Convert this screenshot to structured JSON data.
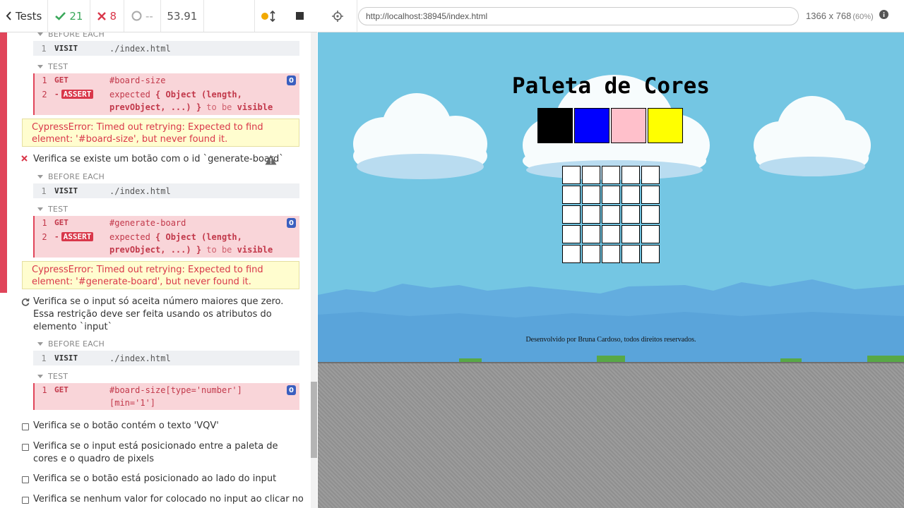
{
  "reporter": {
    "tests_label": "Tests",
    "passed": "21",
    "failed": "8",
    "pending": "--",
    "duration": "53.91",
    "colors": {
      "pass": "#3aa85a",
      "fail": "#d9374a",
      "badge": "#3a5fbf"
    }
  },
  "runnables": {
    "block1": {
      "before_each": "BEFORE EACH",
      "visit_num": "1",
      "visit_name": "VISIT",
      "visit_url": "./index.html",
      "test_label": "TEST",
      "get_num": "1",
      "get_name": "GET",
      "get_selector": "#board-size",
      "get_count": "0",
      "assert_num": "2",
      "assert_dash": "-",
      "assert_name": "ASSERT",
      "assert_expected": "expected",
      "assert_object": "{ Object (length,",
      "assert_object2": "prevObject, ...) }",
      "assert_tobe": "to be",
      "assert_visible": "visible",
      "error": "CypressError: Timed out retrying: Expected to find element: '#board-size', but never found it."
    },
    "test2": {
      "title": "Verifica se existe um botão com o id `generate-board`",
      "before_each": "BEFORE EACH",
      "visit_num": "1",
      "visit_name": "VISIT",
      "visit_url": "./index.html",
      "test_label": "TEST",
      "get_num": "1",
      "get_name": "GET",
      "get_selector": "#generate-board",
      "get_count": "0",
      "assert_num": "2",
      "assert_dash": "-",
      "assert_name": "ASSERT",
      "assert_expected": "expected",
      "assert_object": "{ Object (length,",
      "assert_object2": "prevObject, ...) }",
      "assert_tobe": "to be",
      "assert_visible": "visible",
      "error": "CypressError: Timed out retrying: Expected to find element: '#generate-board', but never found it."
    },
    "test3": {
      "title_line1": "Verifica se o input só aceita número maiores que zero.",
      "title_line2": "Essa restrição deve ser feita usando os atributos do",
      "title_line3": "elemento `input`",
      "before_each": "BEFORE EACH",
      "visit_num": "1",
      "visit_name": "VISIT",
      "visit_url": "./index.html",
      "test_label": "TEST",
      "get_num": "1",
      "get_name": "GET",
      "get_selector_line1": "#board-size[type='number']",
      "get_selector_line2": "[min='1']",
      "get_count": "0"
    },
    "pending_tests": [
      "Verifica se o botão contém o texto 'VQV'",
      "Verifica se o input está posicionado entre a paleta de",
      "cores e o quadro de pixels",
      "Verifica se o botão está posicionado ao lado do input",
      "Verifica se nenhum valor for colocado no input ao clicar no"
    ]
  },
  "app": {
    "url": "http://localhost:38945/index.html",
    "viewport": "1366 x 768",
    "viewport_pct": "(60%)",
    "page_title": "Paleta de Cores",
    "palette_colors": [
      "#000000",
      "#0000ff",
      "#ffc0cb",
      "#ffff00"
    ],
    "board_size": 5,
    "footer": "Desenvolvido por Bruna Cardoso, todos direitos reservados."
  }
}
